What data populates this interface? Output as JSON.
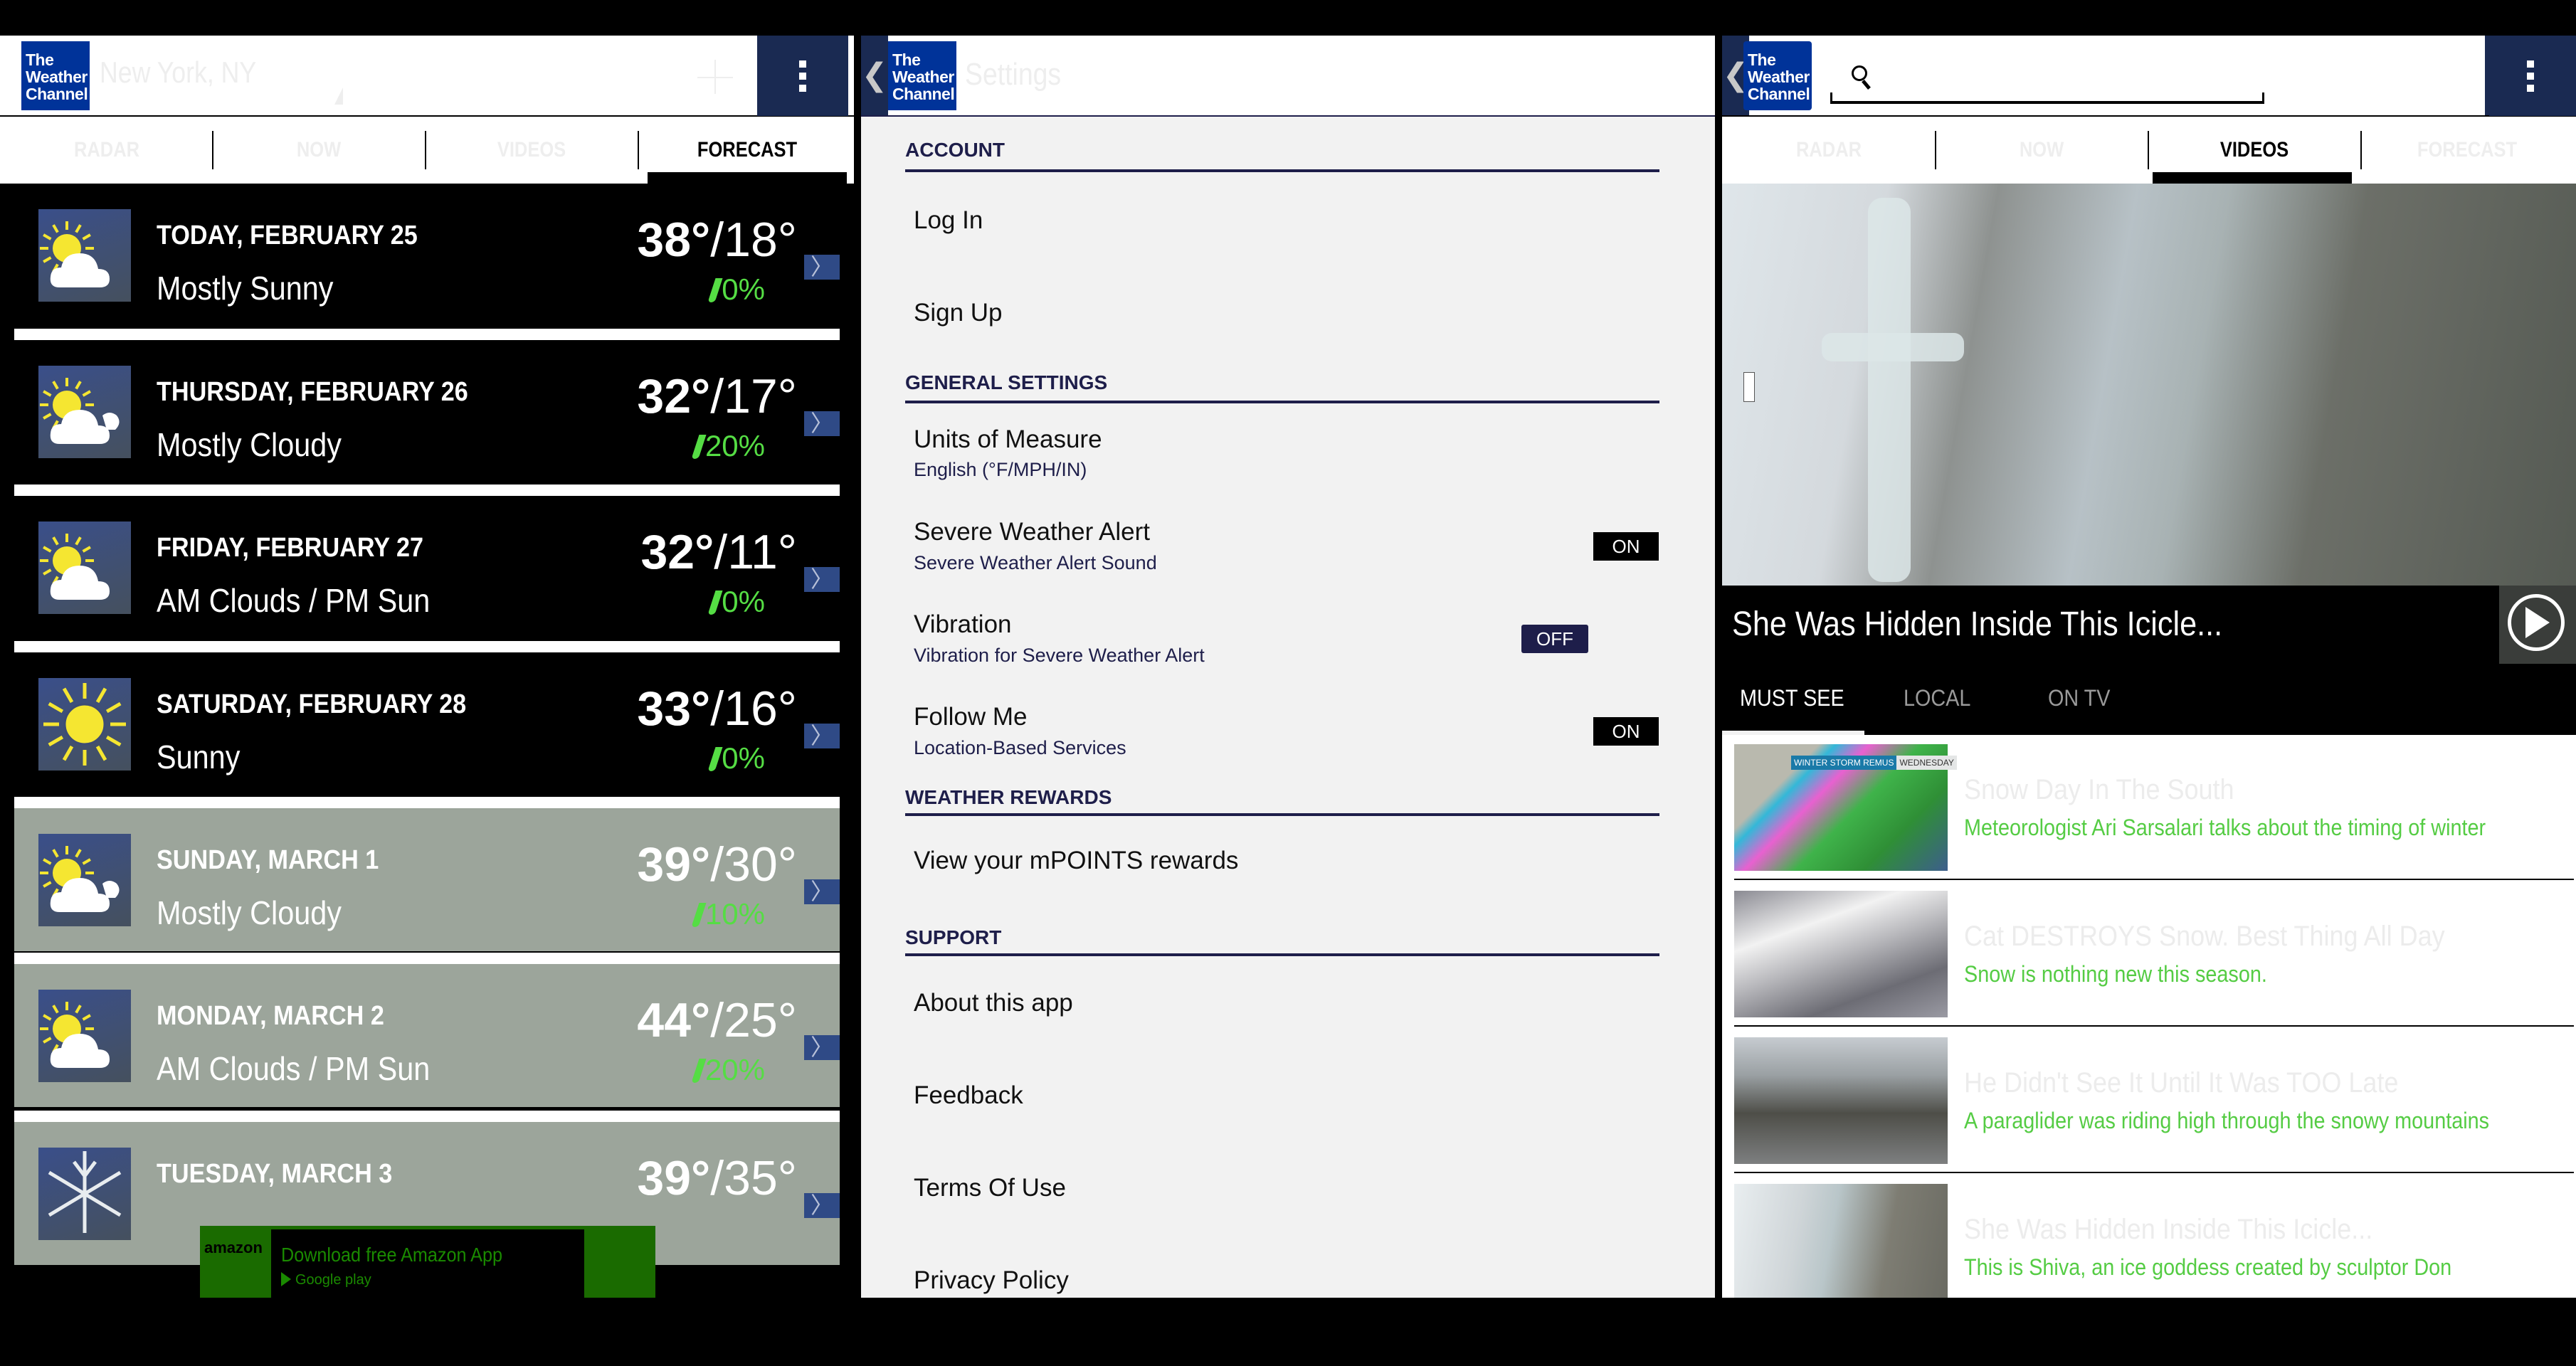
{
  "forecast_screen": {
    "logo_text": [
      "The",
      "Weather",
      "Channel"
    ],
    "location": "New York, NY",
    "add_icon": "plus-icon",
    "menu_icon": "overflow-menu-icon",
    "tabs": [
      {
        "label": "RADAR",
        "active": false
      },
      {
        "label": "NOW",
        "active": false
      },
      {
        "label": "VIDEOS",
        "active": false
      },
      {
        "label": "FORECAST",
        "active": true
      }
    ],
    "days": [
      {
        "day": "TODAY, FEBRUARY 25",
        "condition": "Mostly Sunny",
        "high": "38°",
        "low": "18°",
        "precip": "0%",
        "icon": "partly-sunny-icon"
      },
      {
        "day": "THURSDAY, FEBRUARY 26",
        "condition": "Mostly Cloudy",
        "high": "32°",
        "low": "17°",
        "precip": "20%",
        "icon": "mostly-cloudy-icon"
      },
      {
        "day": "FRIDAY, FEBRUARY 27",
        "condition": "AM Clouds / PM Sun",
        "high": "32°",
        "low": "11°",
        "precip": "0%",
        "icon": "partly-sunny-icon"
      },
      {
        "day": "SATURDAY, FEBRUARY 28",
        "condition": "Sunny",
        "high": "33°",
        "low": "16°",
        "precip": "0%",
        "icon": "sunny-icon"
      },
      {
        "day": "SUNDAY, MARCH 1",
        "condition": "Mostly Cloudy",
        "high": "39°",
        "low": "30°",
        "precip": "10%",
        "icon": "mostly-cloudy-icon"
      },
      {
        "day": "MONDAY, MARCH 2",
        "condition": "AM Clouds / PM Sun",
        "high": "44°",
        "low": "25°",
        "precip": "20%",
        "icon": "partly-sunny-icon"
      },
      {
        "day": "TUESDAY, MARCH 3",
        "condition": "",
        "high": "39°",
        "low": "35°",
        "precip": "",
        "icon": "snow-icon"
      }
    ],
    "ad": {
      "brand": "amazon",
      "text": "Download free Amazon App",
      "store": "Google play"
    }
  },
  "settings_screen": {
    "logo_text": [
      "The",
      "Weather",
      "Channel"
    ],
    "title": "Settings",
    "sections": [
      {
        "header": "ACCOUNT",
        "items": [
          {
            "label": "Log In"
          },
          {
            "label": "Sign Up"
          }
        ]
      },
      {
        "header": "GENERAL SETTINGS",
        "items": [
          {
            "label": "Units of Measure",
            "sub": "English (°F/MPH/IN)"
          },
          {
            "label": "Severe Weather Alert",
            "sub": "Severe Weather Alert Sound",
            "toggle": "ON"
          },
          {
            "label": "Vibration",
            "sub": "Vibration for Severe Weather Alert",
            "toggle": "OFF"
          },
          {
            "label": "Follow Me",
            "sub": "Location-Based Services",
            "toggle": "ON"
          }
        ]
      },
      {
        "header": "WEATHER REWARDS",
        "items": [
          {
            "label": "View your mPOINTS rewards"
          }
        ]
      },
      {
        "header": "SUPPORT",
        "items": [
          {
            "label": "About this app"
          },
          {
            "label": "Feedback"
          },
          {
            "label": "Terms Of Use"
          },
          {
            "label": "Privacy Policy"
          }
        ]
      }
    ]
  },
  "videos_screen": {
    "logo_text": [
      "The",
      "Weather",
      "Channel"
    ],
    "search_value": "",
    "tabs": [
      {
        "label": "RADAR",
        "active": false
      },
      {
        "label": "NOW",
        "active": false
      },
      {
        "label": "VIDEOS",
        "active": true
      },
      {
        "label": "FORECAST",
        "active": false
      }
    ],
    "featured_title": "She Was Hidden Inside This Icicle...",
    "video_tabs": [
      {
        "label": "MUST SEE",
        "active": true
      },
      {
        "label": "LOCAL",
        "active": false
      },
      {
        "label": "ON TV",
        "active": false
      }
    ],
    "videos": [
      {
        "title": "Snow Day In The South",
        "description": "Meteorologist Ari Sarsalari talks about the timing of winter",
        "thumb_caption": [
          "WINTER STORM REMUS",
          "WEDNESDAY"
        ]
      },
      {
        "title": "Cat DESTROYS Snow. Best Thing All Day",
        "description": "Snow is nothing new this season."
      },
      {
        "title": "He Didn't See It Until It Was TOO Late",
        "description": "A paraglider was riding high through the snowy mountains"
      },
      {
        "title": "She Was Hidden Inside This Icicle...",
        "description": "This is Shiva, an ice goddess created by sculptor Don"
      }
    ]
  },
  "colors": {
    "brand_blue": "#003399",
    "navy": "#1a2a52",
    "section_navy": "#1e1e4a",
    "precip_green": "#55dd44",
    "desc_green": "#55cc44"
  }
}
